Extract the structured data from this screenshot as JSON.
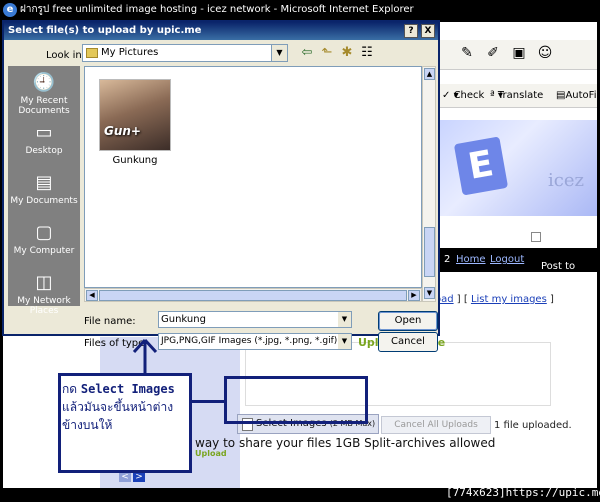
{
  "browser": {
    "title": "ฝากรูป free unlimited image hosting - icez network - Microsoft Internet Explorer",
    "links": [
      "Check",
      "Translate",
      "AutoFill"
    ]
  },
  "page": {
    "nav": {
      "count": "2",
      "home": "Home",
      "logout": "Logout"
    },
    "post_to_twitter": "Post to twitte",
    "upload_links_prefix": "oad",
    "upload_links_sep": " ] [ ",
    "my_images": "List my images",
    "upload_links_suffix": " ]",
    "upload_queue": "Upload Queue",
    "select_images": "Select Images",
    "select_images_max": "(2 MB Max)",
    "cancel_all": "Cancel All Uploads",
    "status": "1 file uploaded.",
    "promo": "way to share your files 1GB Split-archives allowed",
    "promo_sub": "Upload",
    "page_nav": [
      "<",
      ">"
    ],
    "banner_text": "icez"
  },
  "dialog": {
    "title": "Select file(s) to upload by upic.me",
    "help_btn": "?",
    "close_btn": "X",
    "look_in_label": "Look in:",
    "look_in_value": "My Pictures",
    "places": [
      {
        "label": "My Recent Documents",
        "icon": "recent-docs-icon"
      },
      {
        "label": "Desktop",
        "icon": "desktop-icon"
      },
      {
        "label": "My Documents",
        "icon": "my-documents-icon"
      },
      {
        "label": "My Computer",
        "icon": "my-computer-icon"
      },
      {
        "label": "My Network Places",
        "icon": "network-places-icon"
      }
    ],
    "file": {
      "name": "Gunkung",
      "thumb_text": "Gun+"
    },
    "file_name_label": "File name:",
    "file_name_value": "Gunkung",
    "files_of_type_label": "Files of type:",
    "files_of_type_value": "JPG,PNG,GIF Images (*.jpg, *.png, *.gif) (*.jpg;*.jp",
    "open": "Open",
    "cancel": "Cancel"
  },
  "annotation": {
    "line1_prefix": "กด ",
    "line1_highlight": "Select Images",
    "line2": "แล้วมันจะขึ้นหน้าต่าง",
    "line3": "ข้างบนให้"
  },
  "watermark": "[774x623]https://upic.me/"
}
